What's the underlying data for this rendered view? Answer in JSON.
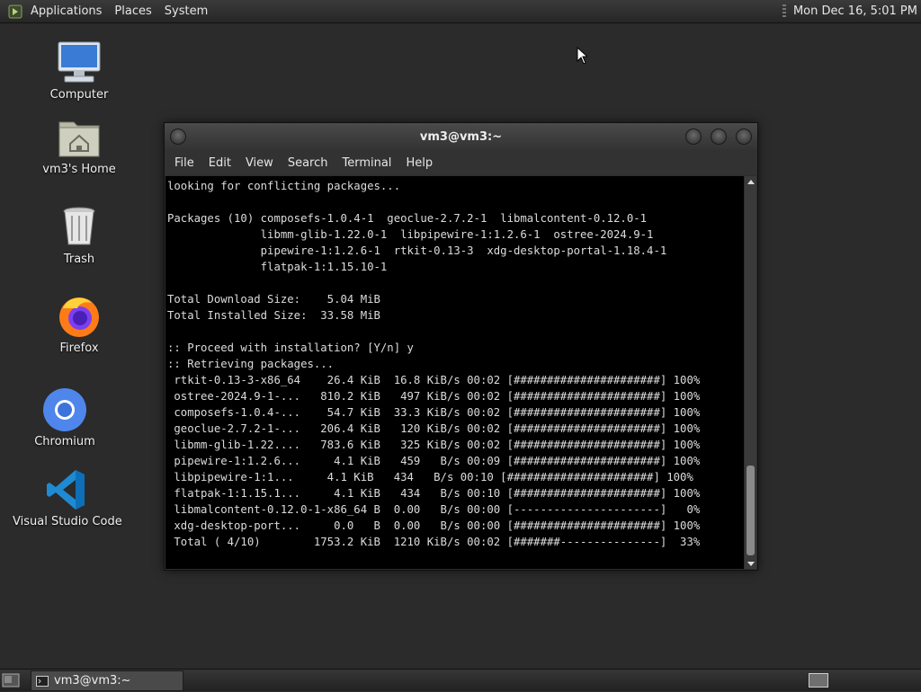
{
  "top_panel": {
    "menus": [
      "Applications",
      "Places",
      "System"
    ],
    "clock": "Mon Dec 16,  5:01 PM"
  },
  "desktop": {
    "icons": [
      {
        "label": "Computer",
        "icon": "computer-icon"
      },
      {
        "label": "vm3's Home",
        "icon": "home-folder-icon"
      },
      {
        "label": "Trash",
        "icon": "trash-icon"
      },
      {
        "label": "Firefox",
        "icon": "firefox-icon"
      },
      {
        "label": "Chromium",
        "icon": "chromium-icon"
      },
      {
        "label": "Visual Studio Code",
        "icon": "vscode-icon"
      }
    ]
  },
  "terminal": {
    "title": "vm3@vm3:~",
    "menu": [
      "File",
      "Edit",
      "View",
      "Search",
      "Terminal",
      "Help"
    ],
    "lines": [
      "looking for conflicting packages...",
      "",
      "Packages (10) composefs-1.0.4-1  geoclue-2.7.2-1  libmalcontent-0.12.0-1",
      "              libmm-glib-1.22.0-1  libpipewire-1:1.2.6-1  ostree-2024.9-1",
      "              pipewire-1:1.2.6-1  rtkit-0.13-3  xdg-desktop-portal-1.18.4-1",
      "              flatpak-1:1.15.10-1",
      "",
      "Total Download Size:    5.04 MiB",
      "Total Installed Size:  33.58 MiB",
      "",
      ":: Proceed with installation? [Y/n] y",
      ":: Retrieving packages...",
      " rtkit-0.13-3-x86_64    26.4 KiB  16.8 KiB/s 00:02 [######################] 100%",
      " ostree-2024.9-1-...   810.2 KiB   497 KiB/s 00:02 [######################] 100%",
      " composefs-1.0.4-...    54.7 KiB  33.3 KiB/s 00:02 [######################] 100%",
      " geoclue-2.7.2-1-...   206.4 KiB   120 KiB/s 00:02 [######################] 100%",
      " libmm-glib-1.22....   783.6 KiB   325 KiB/s 00:02 [######################] 100%",
      " pipewire-1:1.2.6...     4.1 KiB   459   B/s 00:09 [######################] 100%",
      " libpipewire-1:1...     4.1 KiB   434   B/s 00:10 [######################] 100%",
      " flatpak-1:1.15.1...     4.1 KiB   434   B/s 00:10 [######################] 100%",
      " libmalcontent-0.12.0-1-x86_64 B  0.00   B/s 00:00 [----------------------]   0%",
      " xdg-desktop-port...     0.0   B  0.00   B/s 00:00 [######################] 100%",
      " Total ( 4/10)        1753.2 KiB  1210 KiB/s 00:02 [#######---------------]  33%"
    ]
  },
  "taskbar": {
    "task_label": "vm3@vm3:~"
  }
}
